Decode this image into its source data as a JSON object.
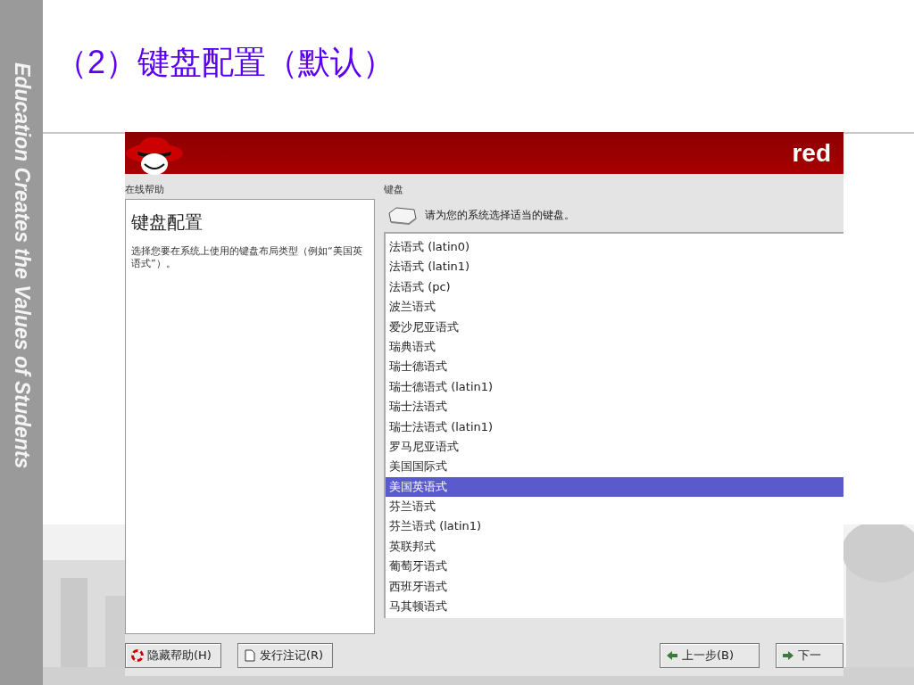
{
  "slide": {
    "sidebar_text": "Education Creates the Values of Students",
    "title": "（2）键盘配置（默认）"
  },
  "installer": {
    "brand": "red",
    "help": {
      "label": "在线帮助",
      "heading": "键盘配置",
      "text": "选择您要在系统上使用的键盘布局类型（例如“美国英语式”）。"
    },
    "keyboard": {
      "label": "键盘",
      "prompt": "请为您的系统选择适当的键盘。",
      "layouts": [
        {
          "name": "法语式 (latin0)",
          "selected": false
        },
        {
          "name": "法语式 (latin1)",
          "selected": false
        },
        {
          "name": "法语式 (pc)",
          "selected": false
        },
        {
          "name": "波兰语式",
          "selected": false
        },
        {
          "name": "爱沙尼亚语式",
          "selected": false
        },
        {
          "name": "瑞典语式",
          "selected": false
        },
        {
          "name": "瑞士德语式",
          "selected": false
        },
        {
          "name": "瑞士德语式 (latin1)",
          "selected": false
        },
        {
          "name": "瑞士法语式",
          "selected": false
        },
        {
          "name": "瑞士法语式 (latin1)",
          "selected": false
        },
        {
          "name": "罗马尼亚语式",
          "selected": false
        },
        {
          "name": "美国国际式",
          "selected": false
        },
        {
          "name": "美国英语式",
          "selected": true
        },
        {
          "name": "芬兰语式",
          "selected": false
        },
        {
          "name": "芬兰语式 (latin1)",
          "selected": false
        },
        {
          "name": "英联邦式",
          "selected": false
        },
        {
          "name": "葡萄牙语式",
          "selected": false
        },
        {
          "name": "西班牙语式",
          "selected": false
        },
        {
          "name": "马其顿语式",
          "selected": false
        }
      ]
    },
    "buttons": [
      {
        "label": "隐藏帮助(H)",
        "kind": "help"
      },
      {
        "label": "发行注记(R)",
        "kind": "notes"
      },
      {
        "label": "上一步(B)",
        "kind": "back"
      },
      {
        "label": "下一",
        "kind": "next"
      }
    ]
  }
}
